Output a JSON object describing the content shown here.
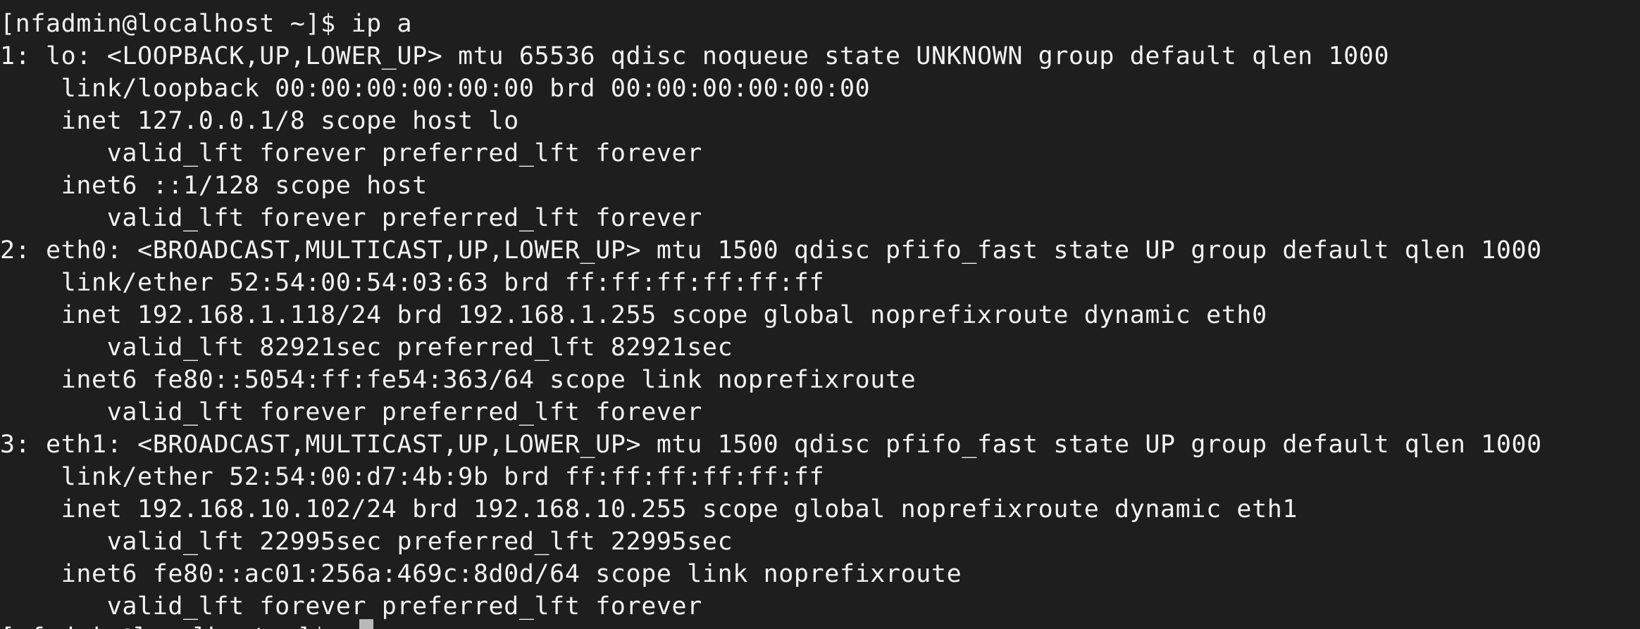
{
  "terminal": {
    "prompt": "[nfadmin@localhost ~]$ ip a",
    "lines": [
      "1: lo: <LOOPBACK,UP,LOWER_UP> mtu 65536 qdisc noqueue state UNKNOWN group default qlen 1000",
      "    link/loopback 00:00:00:00:00:00 brd 00:00:00:00:00:00",
      "    inet 127.0.0.1/8 scope host lo",
      "       valid_lft forever preferred_lft forever",
      "    inet6 ::1/128 scope host",
      "       valid_lft forever preferred_lft forever",
      "2: eth0: <BROADCAST,MULTICAST,UP,LOWER_UP> mtu 1500 qdisc pfifo_fast state UP group default qlen 1000",
      "    link/ether 52:54:00:54:03:63 brd ff:ff:ff:ff:ff:ff",
      "    inet 192.168.1.118/24 brd 192.168.1.255 scope global noprefixroute dynamic eth0",
      "       valid_lft 82921sec preferred_lft 82921sec",
      "    inet6 fe80::5054:ff:fe54:363/64 scope link noprefixroute",
      "       valid_lft forever preferred_lft forever",
      "3: eth1: <BROADCAST,MULTICAST,UP,LOWER_UP> mtu 1500 qdisc pfifo_fast state UP group default qlen 1000",
      "    link/ether 52:54:00:d7:4b:9b brd ff:ff:ff:ff:ff:ff",
      "    inet 192.168.10.102/24 brd 192.168.10.255 scope global noprefixroute dynamic eth1",
      "       valid_lft 22995sec preferred_lft 22995sec",
      "    inet6 fe80::ac01:256a:469c:8d0d/64 scope link noprefixroute",
      "       valid_lft forever preferred_lft forever"
    ],
    "next_prompt_partial": "[nfadmin@localhost ~]$ "
  },
  "colors": {
    "background": "#1e1e1e",
    "foreground": "#f2f2f2",
    "cursor": "#b9b9b9"
  }
}
